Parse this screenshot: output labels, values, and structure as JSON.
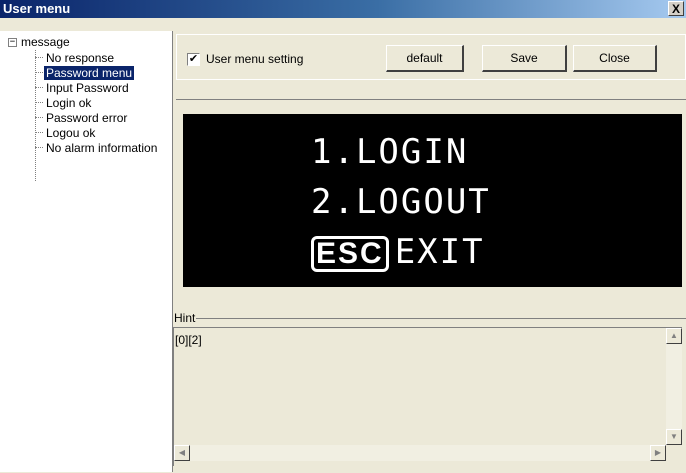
{
  "window": {
    "title": "User menu",
    "close_glyph": "X"
  },
  "tree": {
    "root_label": "message",
    "expander_glyph": "−",
    "items": [
      {
        "label": "No response",
        "selected": false
      },
      {
        "label": "Password menu",
        "selected": true
      },
      {
        "label": "Input Password",
        "selected": false
      },
      {
        "label": "Login ok",
        "selected": false
      },
      {
        "label": "Password error",
        "selected": false
      },
      {
        "label": "Logou ok",
        "selected": false
      },
      {
        "label": "No alarm information",
        "selected": false
      }
    ]
  },
  "toolbar": {
    "checkbox_label": "User menu setting",
    "checkbox_checked": true,
    "checkbox_glyph": "✔",
    "default_label": "default",
    "save_label": "Save",
    "close_label": "Close"
  },
  "display": {
    "line1": "1.LOGIN",
    "line2": "2.LOGOUT",
    "esc_key": "ESC",
    "line3_text": "EXIT"
  },
  "hint": {
    "label": "Hint",
    "text": "[0][2]"
  },
  "icons": {
    "scroll_up": "up-arrow-icon",
    "scroll_down": "down-arrow-icon",
    "scroll_left": "left-arrow-icon",
    "scroll_right": "right-arrow-icon"
  },
  "colors": {
    "selection": "#0a246a",
    "title_bar": "#0a246a",
    "lcd_background": "#000000"
  }
}
